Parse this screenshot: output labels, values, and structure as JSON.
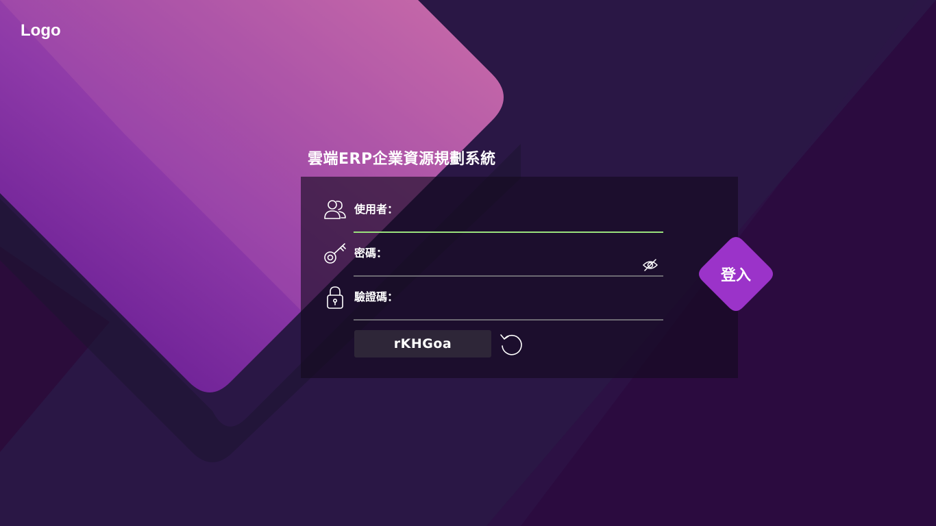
{
  "brand": {
    "logo_text": "Logo"
  },
  "title": "雲端ERP企業資源規劃系統",
  "form": {
    "username": {
      "label": "使用者：",
      "value": "",
      "icon": "users-icon"
    },
    "password": {
      "label": "密碼：",
      "value": "",
      "icon": "key-icon",
      "toggle_icon": "eye-slash-icon"
    },
    "captcha_field": {
      "label": "驗證碼：",
      "value": "",
      "icon": "lock-icon"
    },
    "captcha_code": "rKHGoa",
    "refresh_icon": "refresh-icon"
  },
  "login_button": {
    "label": "登入"
  },
  "colors": {
    "background": "#2a1745",
    "accent": "#9b33c9",
    "active_underline": "#9be27d",
    "diamond_gradient_start": "#6a1a9a",
    "diamond_gradient_end": "#d067a6"
  }
}
